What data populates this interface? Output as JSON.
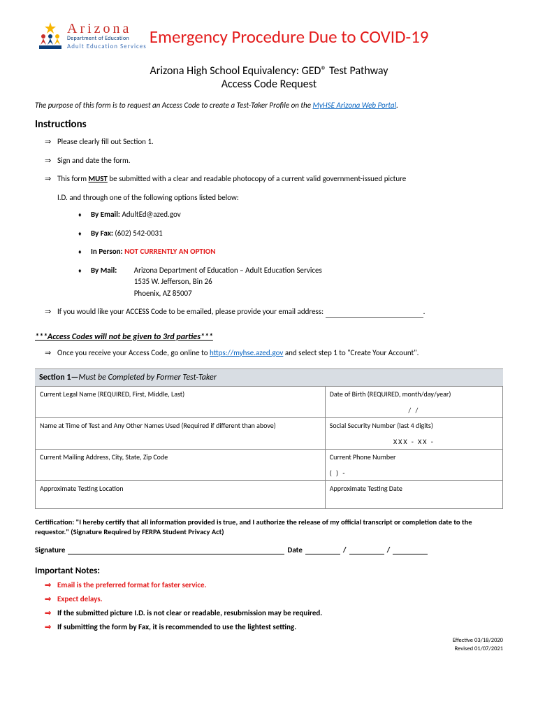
{
  "logo": {
    "state": "Arizona",
    "dept": "Department of Education",
    "program": "Adult Education Services"
  },
  "banner": "Emergency Procedure Due to COVID-19",
  "title": {
    "line1": "Arizona High School Equivalency: GED® Test Pathway",
    "line2": "Access Code Request"
  },
  "purpose": {
    "prefix": "The purpose of this form is to request an Access Code to create a Test-Taker Profile on the ",
    "link_text": "MyHSE Arizona Web Portal",
    "suffix": "."
  },
  "instructions": {
    "heading": "Instructions",
    "items": {
      "i1": "Please clearly fill out Section 1.",
      "i2": "Sign and date the form.",
      "i3_pre": "This form ",
      "i3_must": "MUST",
      "i3_post1": " be submitted with a clear and readable photocopy of a current valid government-issued picture",
      "i3_post2": "I.D. and through one of the following options listed below:",
      "sub": {
        "email_label": "By Email:",
        "email_value": "AdultEd@azed.gov",
        "fax_label": "By Fax:",
        "fax_value": "(602) 542-0031",
        "person_label": "In Person:",
        "person_value": "NOT CURRENTLY AN OPTION",
        "mail_label": "By Mail:",
        "mail_line1": "Arizona Department of Education – Adult Education Services",
        "mail_line2": "1535 W. Jefferson, Bin 26",
        "mail_line3": "Phoenix, AZ 85007"
      },
      "i4": "If you would like your ACCESS Code to be emailed, please provide your email address: ",
      "i4_suffix": "."
    }
  },
  "third_party_notice": "***Access Codes will not be given to 3rd parties***",
  "online": {
    "prefix": "Once you receive your Access Code, go online to ",
    "link": "https://myhse.azed.gov",
    "suffix": " and select step 1 to \"Create Your Account\"."
  },
  "section1": {
    "header_label": "Section 1—",
    "header_desc": "Must be Completed by Former Test-Taker",
    "fields": {
      "legal_name_label": "Current Legal Name (REQUIRED, First, Middle, Last)",
      "dob_label": "Date of Birth (REQUIRED, month/day/year)",
      "dob_value": "/               /",
      "prior_name_label": "Name at Time of Test and Any Other Names Used (Required if different than above)",
      "ssn_label": "Social Security Number (last 4 digits)",
      "ssn_value": "XXX   -   XX   -",
      "address_label": "Current Mailing Address, City, State, Zip Code",
      "phone_label": "Current Phone Number",
      "phone_value": "(          )              -",
      "location_label": "Approximate Testing Location",
      "date_label": "Approximate Testing Date"
    }
  },
  "certification": "Certification: \"I hereby certify that all information provided is true, and I authorize the release of my official transcript or completion date to the requestor.\" (Signature Required by FERPA Student Privacy Act)",
  "signature_label": "Signature",
  "date_label": "Date",
  "notes": {
    "heading": "Important Notes:",
    "n1": "Email is the preferred format for faster service.",
    "n2": "Expect delays.",
    "n3": "If the submitted picture I.D. is not clear or readable, resubmission may be required.",
    "n4": "If submitting the form by Fax, it is recommended to use the lightest setting."
  },
  "footer": {
    "effective": "Effective 03/18/2020",
    "revised": "Revised 01/07/2021"
  }
}
